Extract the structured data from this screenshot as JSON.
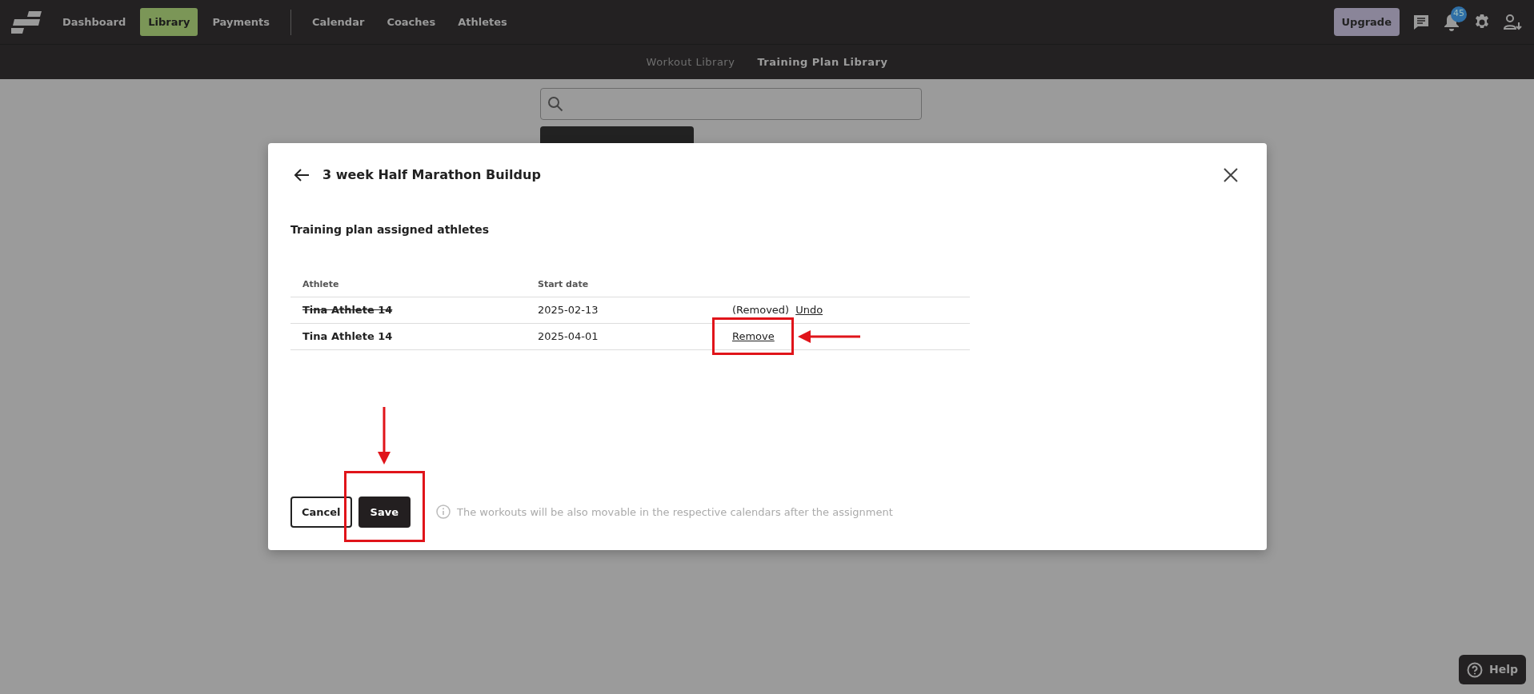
{
  "nav": {
    "items": [
      {
        "label": "Dashboard",
        "selected": false
      },
      {
        "label": "Library",
        "selected": true
      },
      {
        "label": "Payments",
        "selected": false
      },
      {
        "label": "Calendar",
        "selected": false
      },
      {
        "label": "Coaches",
        "selected": false
      },
      {
        "label": "Athletes",
        "selected": false
      }
    ],
    "upgrade": "Upgrade",
    "notifications": "45"
  },
  "subnav": [
    {
      "label": "Workout Library",
      "selected": false
    },
    {
      "label": "Training Plan Library",
      "selected": true
    }
  ],
  "dialog": {
    "title": "3 week Half Marathon Buildup",
    "subtitle": "Training plan assigned athletes",
    "columns": [
      "Athlete",
      "Start date"
    ],
    "rows": [
      {
        "athlete": "Tina Athlete 14",
        "start_date": "2025-02-13",
        "removed": true,
        "status": "(Removed)",
        "action": "Undo",
        "highlighted": false
      },
      {
        "athlete": "Tina Athlete 14",
        "start_date": "2025-04-01",
        "removed": false,
        "action": "Remove",
        "highlighted": true
      }
    ],
    "cancel": "Cancel",
    "save": {
      "label": "Save",
      "highlighted": true
    },
    "info": "The workouts will be also movable in the respective calendars after the assignment"
  },
  "help": "Help"
}
